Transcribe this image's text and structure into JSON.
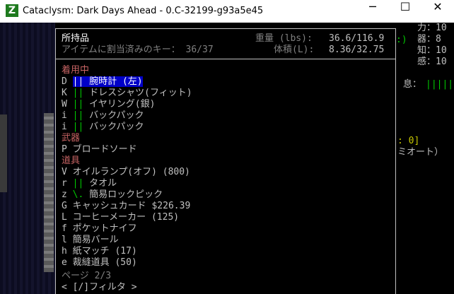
{
  "window": {
    "title": "Cataclysm: Dark Days Ahead - 0.C-32199-g93a5e45",
    "icon": "Z",
    "minimize": "─",
    "maximize": "☐",
    "close": "✕"
  },
  "right_panel": {
    "stat1": "力：10",
    "stat2": "器：8",
    "stat3": "知：10",
    "stat4": "感：10",
    "bracket": ":)",
    "focus_label": "息：",
    "focus_bars": "|||||",
    "zero": ": 0]",
    "mode": "ミオート）"
  },
  "inventory": {
    "title": "所持品",
    "keys_assigned": "アイテムに割当済みのキー： 36/37",
    "weight_label": "重量 (lbs):",
    "weight_value": "36.6/116.9",
    "volume_label": "体積(L):",
    "volume_value": "8.36/32.75",
    "sections": [
      {
        "name": "着用中",
        "items": [
          {
            "key": "D",
            "mark": "||",
            "name": "腕時計 (左)",
            "selected": true
          },
          {
            "key": "K",
            "mark": "||",
            "name": "ドレスシャツ(フィット)"
          },
          {
            "key": "W",
            "mark": "||",
            "name": "イヤリング(銀)"
          },
          {
            "key": "i",
            "mark": "||",
            "name": "バックパック"
          },
          {
            "key": "i",
            "mark": "||",
            "name": "バックパック"
          }
        ]
      },
      {
        "name": "武器",
        "items": [
          {
            "key": "P",
            "mark": "",
            "name": "ブロードソード"
          }
        ]
      },
      {
        "name": "道具",
        "items": [
          {
            "key": "V",
            "mark": "",
            "name": "オイルランプ(オフ) (800)"
          },
          {
            "key": "r",
            "mark": "||",
            "name": "タオル"
          },
          {
            "key": "z",
            "mark": "\\.",
            "name": "簡易ロックピック"
          },
          {
            "key": "G",
            "mark": "",
            "name": "キャッシュカード $226.39"
          },
          {
            "key": "L",
            "mark": "",
            "name": "コーヒーメーカー (125)"
          },
          {
            "key": "f",
            "mark": "",
            "name": "ポケットナイフ"
          },
          {
            "key": "l",
            "mark": "",
            "name": "簡易バール"
          },
          {
            "key": "h",
            "mark": "",
            "name": "紙マッチ (17)"
          },
          {
            "key": "e",
            "mark": "",
            "name": "裁縫道具 (50)"
          }
        ]
      }
    ],
    "page": "ページ 2/3",
    "filter": "< [/]フィルタ >"
  },
  "colors": {
    "selected_bg": "#0000c8",
    "category": "#c86464",
    "mark": "#00c800",
    "text": "#c0c0c0",
    "dim": "#808080",
    "yellow": "#c8c800"
  }
}
